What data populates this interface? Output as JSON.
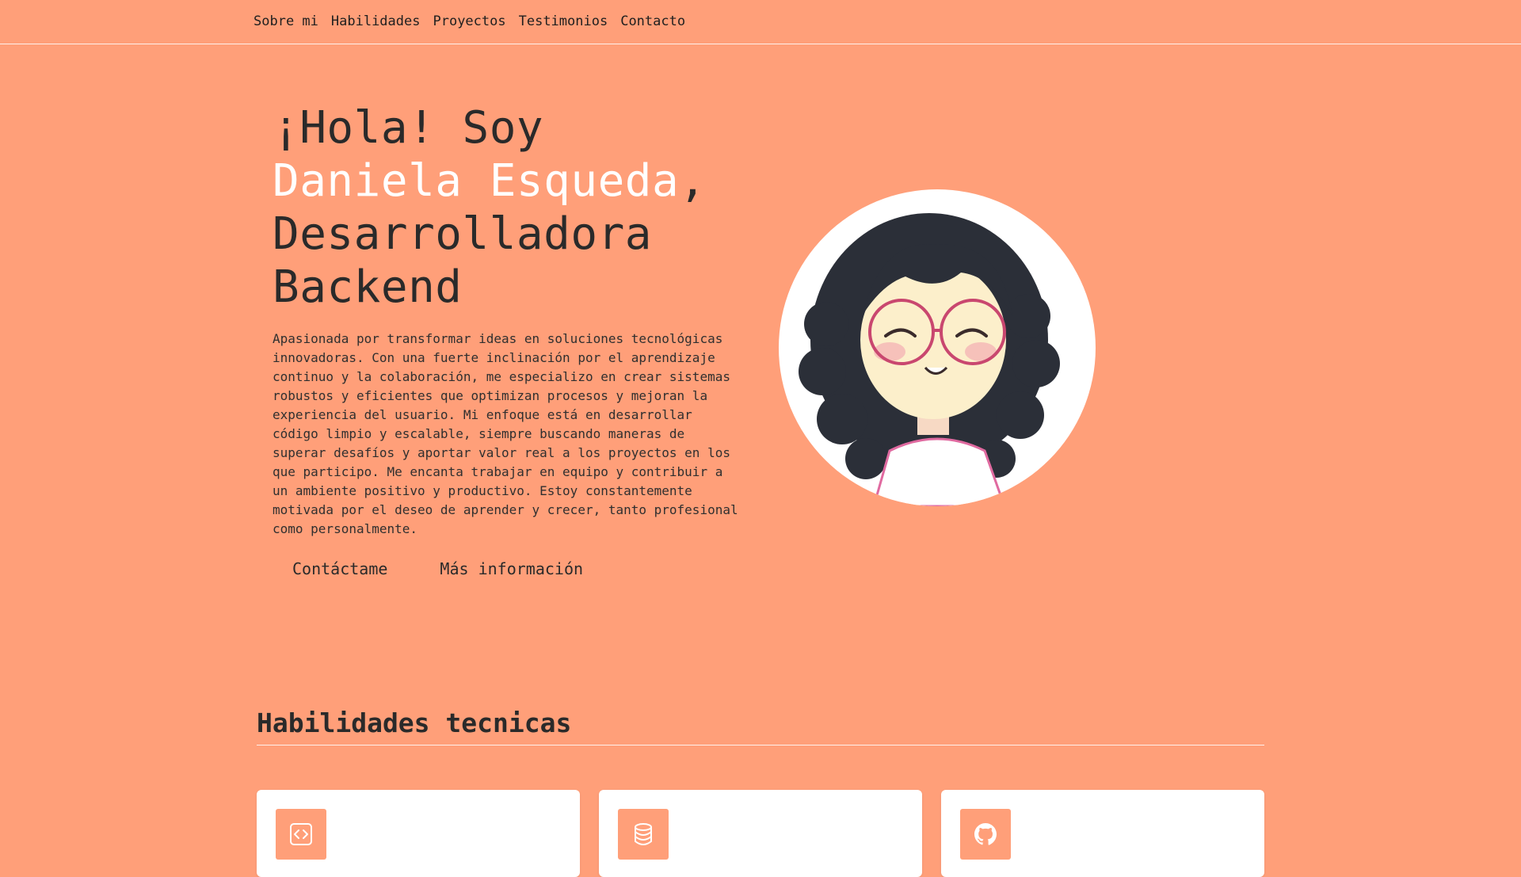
{
  "nav": {
    "items": [
      "Sobre mi",
      "Habilidades",
      "Proyectos",
      "Testimonios",
      "Contacto"
    ]
  },
  "hero": {
    "greeting": "¡Hola! Soy",
    "name": "Daniela Esqueda",
    "comma": ",",
    "role_line1": "Desarrolladora",
    "role_line2": "Backend",
    "description": "Apasionada por transformar ideas en soluciones tecnológicas innovadoras. Con una fuerte inclinación por el aprendizaje continuo y la colaboración, me especializo en crear sistemas robustos y eficientes que optimizan procesos y mejoran la experiencia del usuario. Mi enfoque está en desarrollar código limpio y escalable, siempre buscando maneras de superar desafíos y aportar valor real a los proyectos en los que participo. Me encanta trabajar en equipo y contribuir a un ambiente positivo y productivo. Estoy constantemente motivada por el deseo de aprender y crecer, tanto profesional como personalmente.",
    "contact_button": "Contáctame",
    "more_button": "Más información"
  },
  "skills": {
    "title": "Habilidades tecnicas",
    "cards": [
      {
        "icon": "code-icon"
      },
      {
        "icon": "database-icon"
      },
      {
        "icon": "github-icon"
      }
    ]
  },
  "colors": {
    "background": "#FF9F79",
    "accent_text": "#FFFFFF",
    "card": "#FFFFFF"
  }
}
